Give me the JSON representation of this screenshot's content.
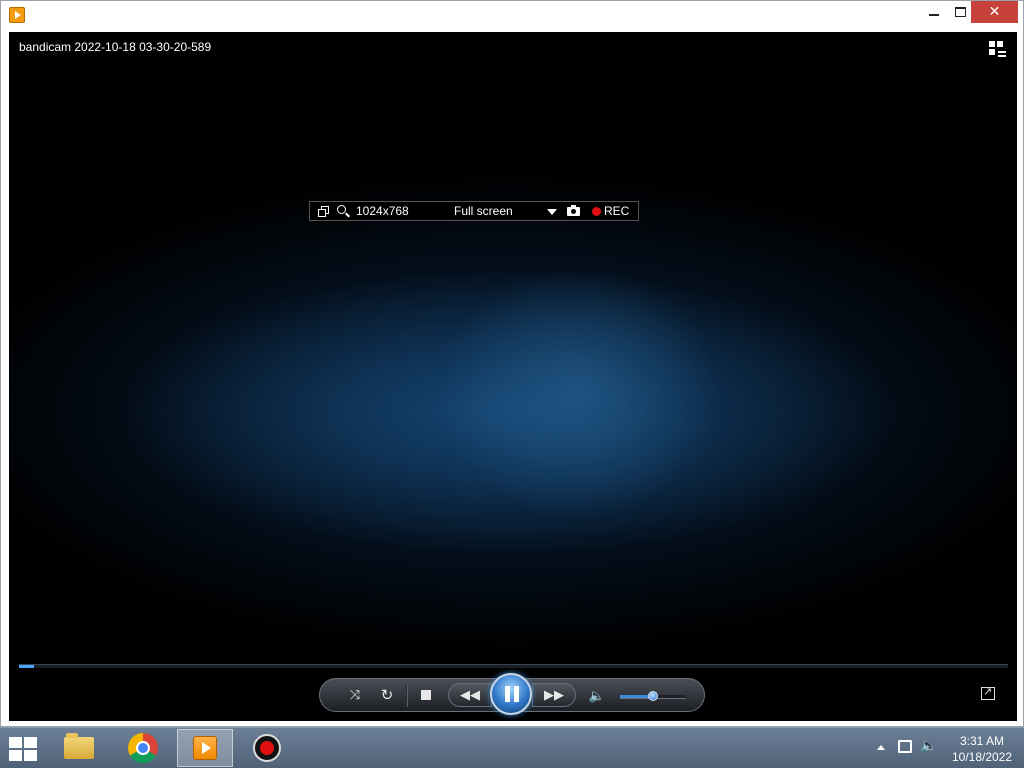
{
  "window": {
    "minimize_label": "—",
    "close_label": "✕"
  },
  "video": {
    "title": "bandicam 2022-10-18 03-30-20-589",
    "progress": 0.015
  },
  "bandicam_bar": {
    "resolution": "1024x768",
    "mode": "Full screen",
    "rec_label": "REC",
    "rec_color": "#e01010"
  },
  "controls": {
    "shuffle_icon": "⤨",
    "repeat_icon": "↻",
    "prev_icon": "◀◀",
    "next_icon": "▶▶",
    "volume_icon": "🔈",
    "volume_level": 0.5,
    "accent_color": "#3a8ad8"
  },
  "taskbar": {
    "items": [
      {
        "name": "file-explorer",
        "active": false
      },
      {
        "name": "chrome",
        "active": false
      },
      {
        "name": "media-player",
        "active": true
      },
      {
        "name": "bandicam",
        "active": false
      }
    ],
    "clock": {
      "time": "3:31 AM",
      "date": "10/18/2022"
    }
  }
}
